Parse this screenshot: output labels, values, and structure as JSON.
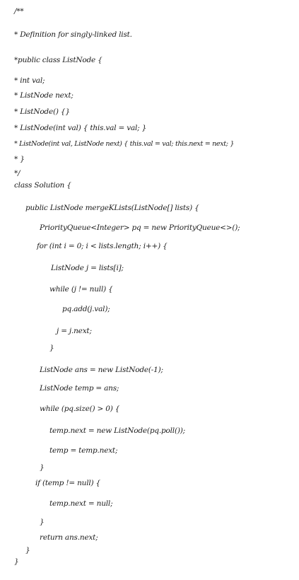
{
  "document": {
    "lines": [
      "/**",
      " * Definition for singly-linked list.",
      " *public class ListNode {",
      " *      int val;",
      " *      ListNode next;",
      " *      ListNode() {}",
      " *      ListNode(int val) { this.val = val; }",
      " *      ListNode(int val, ListNode next) { this.val = val; this.next = next; }",
      " * }",
      " */",
      "class Solution {",
      "public ListNode mergeKLists(ListNode[] lists) {",
      "PriorityQueue<Integer> pq = new PriorityQueue<>();",
      "for (int i = 0; i < lists.length; i++) {",
      "ListNode j = lists[i];",
      "while (j != null) {",
      "pq.add(j.val);",
      "j = j.next;",
      "}",
      "ListNode ans = new ListNode(-1);",
      "ListNode temp = ans;",
      "while (pq.size() > 0) {",
      "temp.next = new ListNode(pq.poll());",
      "temp = temp.next;",
      "}",
      "if (temp != null) {",
      "temp.next = null;",
      "}",
      "return ans.next;",
      "}",
      "}"
    ]
  }
}
